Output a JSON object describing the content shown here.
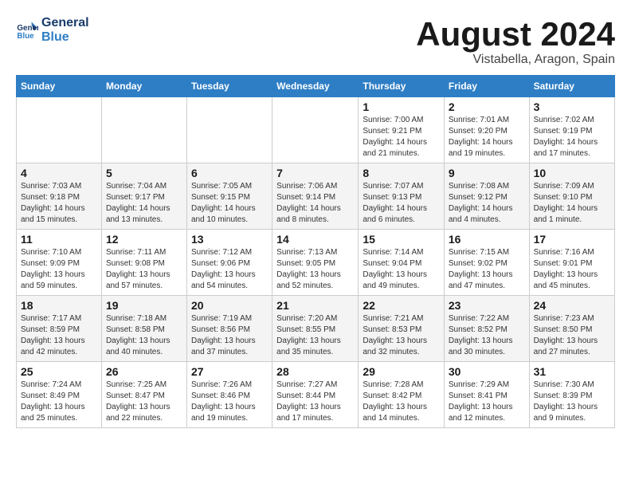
{
  "header": {
    "logo_line1": "General",
    "logo_line2": "Blue",
    "title": "August 2024",
    "subtitle": "Vistabella, Aragon, Spain"
  },
  "days_of_week": [
    "Sunday",
    "Monday",
    "Tuesday",
    "Wednesday",
    "Thursday",
    "Friday",
    "Saturday"
  ],
  "weeks": [
    [
      {
        "day": "",
        "info": ""
      },
      {
        "day": "",
        "info": ""
      },
      {
        "day": "",
        "info": ""
      },
      {
        "day": "",
        "info": ""
      },
      {
        "day": "1",
        "info": "Sunrise: 7:00 AM\nSunset: 9:21 PM\nDaylight: 14 hours\nand 21 minutes."
      },
      {
        "day": "2",
        "info": "Sunrise: 7:01 AM\nSunset: 9:20 PM\nDaylight: 14 hours\nand 19 minutes."
      },
      {
        "day": "3",
        "info": "Sunrise: 7:02 AM\nSunset: 9:19 PM\nDaylight: 14 hours\nand 17 minutes."
      }
    ],
    [
      {
        "day": "4",
        "info": "Sunrise: 7:03 AM\nSunset: 9:18 PM\nDaylight: 14 hours\nand 15 minutes."
      },
      {
        "day": "5",
        "info": "Sunrise: 7:04 AM\nSunset: 9:17 PM\nDaylight: 14 hours\nand 13 minutes."
      },
      {
        "day": "6",
        "info": "Sunrise: 7:05 AM\nSunset: 9:15 PM\nDaylight: 14 hours\nand 10 minutes."
      },
      {
        "day": "7",
        "info": "Sunrise: 7:06 AM\nSunset: 9:14 PM\nDaylight: 14 hours\nand 8 minutes."
      },
      {
        "day": "8",
        "info": "Sunrise: 7:07 AM\nSunset: 9:13 PM\nDaylight: 14 hours\nand 6 minutes."
      },
      {
        "day": "9",
        "info": "Sunrise: 7:08 AM\nSunset: 9:12 PM\nDaylight: 14 hours\nand 4 minutes."
      },
      {
        "day": "10",
        "info": "Sunrise: 7:09 AM\nSunset: 9:10 PM\nDaylight: 14 hours\nand 1 minute."
      }
    ],
    [
      {
        "day": "11",
        "info": "Sunrise: 7:10 AM\nSunset: 9:09 PM\nDaylight: 13 hours\nand 59 minutes."
      },
      {
        "day": "12",
        "info": "Sunrise: 7:11 AM\nSunset: 9:08 PM\nDaylight: 13 hours\nand 57 minutes."
      },
      {
        "day": "13",
        "info": "Sunrise: 7:12 AM\nSunset: 9:06 PM\nDaylight: 13 hours\nand 54 minutes."
      },
      {
        "day": "14",
        "info": "Sunrise: 7:13 AM\nSunset: 9:05 PM\nDaylight: 13 hours\nand 52 minutes."
      },
      {
        "day": "15",
        "info": "Sunrise: 7:14 AM\nSunset: 9:04 PM\nDaylight: 13 hours\nand 49 minutes."
      },
      {
        "day": "16",
        "info": "Sunrise: 7:15 AM\nSunset: 9:02 PM\nDaylight: 13 hours\nand 47 minutes."
      },
      {
        "day": "17",
        "info": "Sunrise: 7:16 AM\nSunset: 9:01 PM\nDaylight: 13 hours\nand 45 minutes."
      }
    ],
    [
      {
        "day": "18",
        "info": "Sunrise: 7:17 AM\nSunset: 8:59 PM\nDaylight: 13 hours\nand 42 minutes."
      },
      {
        "day": "19",
        "info": "Sunrise: 7:18 AM\nSunset: 8:58 PM\nDaylight: 13 hours\nand 40 minutes."
      },
      {
        "day": "20",
        "info": "Sunrise: 7:19 AM\nSunset: 8:56 PM\nDaylight: 13 hours\nand 37 minutes."
      },
      {
        "day": "21",
        "info": "Sunrise: 7:20 AM\nSunset: 8:55 PM\nDaylight: 13 hours\nand 35 minutes."
      },
      {
        "day": "22",
        "info": "Sunrise: 7:21 AM\nSunset: 8:53 PM\nDaylight: 13 hours\nand 32 minutes."
      },
      {
        "day": "23",
        "info": "Sunrise: 7:22 AM\nSunset: 8:52 PM\nDaylight: 13 hours\nand 30 minutes."
      },
      {
        "day": "24",
        "info": "Sunrise: 7:23 AM\nSunset: 8:50 PM\nDaylight: 13 hours\nand 27 minutes."
      }
    ],
    [
      {
        "day": "25",
        "info": "Sunrise: 7:24 AM\nSunset: 8:49 PM\nDaylight: 13 hours\nand 25 minutes."
      },
      {
        "day": "26",
        "info": "Sunrise: 7:25 AM\nSunset: 8:47 PM\nDaylight: 13 hours\nand 22 minutes."
      },
      {
        "day": "27",
        "info": "Sunrise: 7:26 AM\nSunset: 8:46 PM\nDaylight: 13 hours\nand 19 minutes."
      },
      {
        "day": "28",
        "info": "Sunrise: 7:27 AM\nSunset: 8:44 PM\nDaylight: 13 hours\nand 17 minutes."
      },
      {
        "day": "29",
        "info": "Sunrise: 7:28 AM\nSunset: 8:42 PM\nDaylight: 13 hours\nand 14 minutes."
      },
      {
        "day": "30",
        "info": "Sunrise: 7:29 AM\nSunset: 8:41 PM\nDaylight: 13 hours\nand 12 minutes."
      },
      {
        "day": "31",
        "info": "Sunrise: 7:30 AM\nSunset: 8:39 PM\nDaylight: 13 hours\nand 9 minutes."
      }
    ]
  ]
}
